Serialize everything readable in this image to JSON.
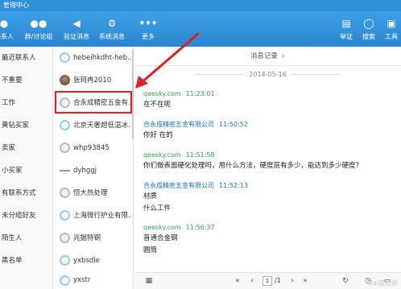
{
  "window": {
    "title": "管理中心"
  },
  "toolbar": {
    "items": [
      {
        "label": "联系人",
        "icon": "contacts-icon",
        "glyph": "●"
      },
      {
        "label": "群/讨论组",
        "icon": "group-icon",
        "glyph": "●●"
      },
      {
        "label": "验证消息",
        "icon": "speaker-icon",
        "glyph": "◀"
      },
      {
        "label": "系统消息",
        "icon": "gear-icon",
        "glyph": "⚙"
      },
      {
        "label": "更多",
        "icon": "more-icon",
        "glyph": "•••"
      },
      {
        "label": "举证",
        "icon": "document-icon",
        "glyph": "▤"
      },
      {
        "label": "搜索",
        "icon": "search-icon",
        "glyph": "◯"
      },
      {
        "label": "工具",
        "icon": "toolbox-icon",
        "glyph": "▣"
      }
    ]
  },
  "categories": [
    "最近联系人",
    "不重要",
    "工作",
    "黄钻买家",
    "卖家",
    "小买家",
    "有联系方式",
    "未分组好友",
    "陌生人",
    "黑名单"
  ],
  "contacts": [
    {
      "name": "hebeihkdht-heb...",
      "avatar": "blue"
    },
    {
      "name": "张珂冉2010",
      "avatar": "photo"
    },
    {
      "name": "合永成精密五金有...",
      "avatar": "gray"
    },
    {
      "name": "北京天奢超低温冰...",
      "avatar": "blue"
    },
    {
      "name": "whp93845",
      "avatar": "gray"
    },
    {
      "name": "dyhggj",
      "avatar": "dash"
    },
    {
      "name": "恒大热处理",
      "avatar": "gray"
    },
    {
      "name": "上海微行护业有限...",
      "avatar": "blue"
    },
    {
      "name": "兆据特钢",
      "avatar": "gray"
    },
    {
      "name": "yxbsdle",
      "avatar": "blue"
    },
    {
      "name": "yxstr",
      "avatar": "blue"
    }
  ],
  "chat": {
    "header": "消息记录",
    "header_dropdown": "∨",
    "date": "2014-05-16",
    "messages": [
      {
        "sender": "qeesky.com",
        "time": "11:23:01",
        "lines": [
          "在不在呢"
        ],
        "side": "me"
      },
      {
        "sender": "合永成精密五金有限公司",
        "time": "11:50:52",
        "lines": [
          "你好 在的"
        ],
        "side": "co"
      },
      {
        "sender": "qeesky.com",
        "time": "11:51:58",
        "lines": [
          "你们做表面硬化处理吗，用什么方法，硬度层有多少，能达到多少硬度？"
        ],
        "side": "me"
      },
      {
        "sender": "合永成精密五金有限公司",
        "time": "11:52:13",
        "lines": [
          "材质",
          "什么工件"
        ],
        "side": "co"
      },
      {
        "sender": "qeesky.com",
        "time": "11:56:37",
        "lines": [
          "普通合金钢",
          "圆筒"
        ],
        "side": "me"
      }
    ]
  },
  "pager": {
    "current": "1",
    "total": "/1"
  },
  "footer_icons": [
    "calendar-icon",
    "first-page-icon",
    "prev-page-icon",
    "next-page-icon",
    "last-page-icon",
    "refresh-icon",
    "history-icon",
    "trash-icon"
  ],
  "watermark": "Bai度经验",
  "colors": {
    "toolbar": "#2f8fd8",
    "highlight": "#e02020",
    "sender_me": "#2aa54a",
    "sender_company": "#1b6fc2"
  }
}
